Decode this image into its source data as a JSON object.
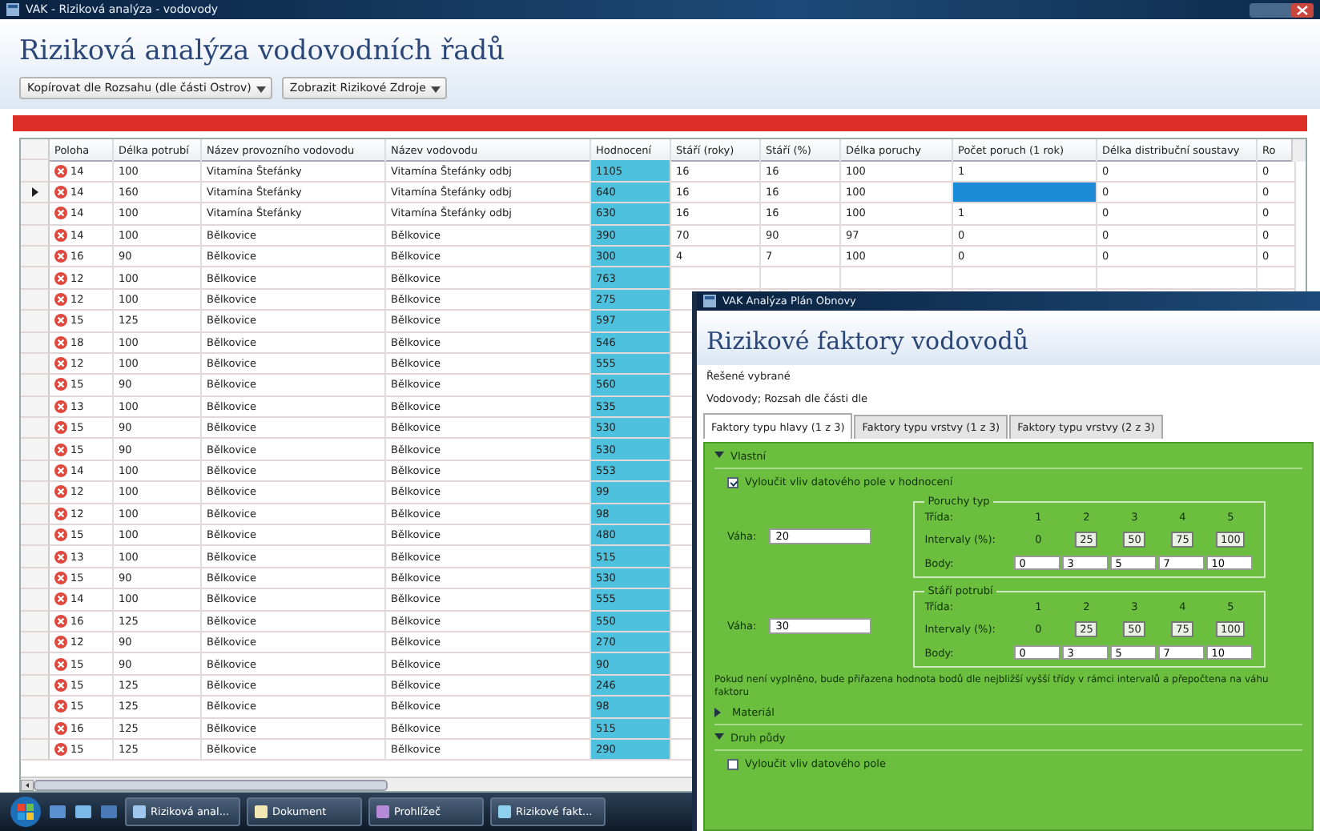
{
  "window": {
    "title": "VAK - Riziková analýza - vodovody"
  },
  "header": {
    "title": "Riziková analýza vodovodních řadů"
  },
  "toolbar": [
    {
      "label": "Kopírovat dle Rozsahu (dle části Ostrov)"
    },
    {
      "label": "Zobrazit Rizikové Zdroje"
    }
  ],
  "table": {
    "columns": [
      {
        "label": "Poloha",
        "highlighted": false
      },
      {
        "label": "Délka potrubí",
        "highlighted": false
      },
      {
        "label": "Název provozního vodovodu",
        "highlighted": false
      },
      {
        "label": "Název vodovodu",
        "highlighted": false
      },
      {
        "label": "Hodnocení",
        "highlighted": true
      },
      {
        "label": "Stáří (roky)",
        "highlighted": false
      },
      {
        "label": "Stáří (%)",
        "highlighted": false
      },
      {
        "label": "Délka poruchy",
        "highlighted": false
      },
      {
        "label": "Počet poruch (1 rok)",
        "highlighted": false
      },
      {
        "label": "Délka distribuční soustavy",
        "highlighted": false
      },
      {
        "label": "Ro",
        "highlighted": false
      }
    ],
    "rows": [
      {
        "current": false,
        "cells": [
          "14",
          "100",
          "Vitamína Štefánky",
          "Vitamína Štefánky odbj",
          "1105"
        ],
        "more": [
          {
            "text": "16",
            "selected": false
          },
          {
            "text": "16",
            "selected": false
          },
          {
            "text": "100",
            "selected": false
          },
          {
            "text": "1",
            "selected": false
          },
          {
            "text": "0",
            "selected": false
          },
          {
            "text": "0",
            "selected": false
          }
        ]
      },
      {
        "current": true,
        "cells": [
          "14",
          "160",
          "Vitamína Štefánky",
          "Vitamína Štefánky odbj",
          "640"
        ],
        "more": [
          {
            "text": "16",
            "selected": false
          },
          {
            "text": "16",
            "selected": false
          },
          {
            "text": "100",
            "selected": false
          },
          {
            "selected": true
          },
          {
            "text": "0",
            "selected": false
          },
          {
            "text": "0",
            "selected": false
          }
        ]
      },
      {
        "current": false,
        "cells": [
          "14",
          "100",
          "Vitamína Štefánky",
          "Vitamína Štefánky odbj",
          "630"
        ],
        "more": [
          {
            "text": "16",
            "selected": false
          },
          {
            "text": "16",
            "selected": false
          },
          {
            "text": "100",
            "selected": false
          },
          {
            "text": "1",
            "selected": false
          },
          {
            "text": "0",
            "selected": false
          },
          {
            "text": "0",
            "selected": false
          }
        ]
      },
      {
        "current": false,
        "cells": [
          "14",
          "100",
          "Bělkovice",
          "Bělkovice",
          "390"
        ],
        "more": [
          {
            "text": "70",
            "selected": false
          },
          {
            "text": "90",
            "selected": false
          },
          {
            "text": "97",
            "selected": false
          },
          {
            "text": "0",
            "selected": false
          },
          {
            "text": "0",
            "selected": false
          },
          {
            "text": "0",
            "selected": false
          }
        ]
      },
      {
        "current": false,
        "cells": [
          "16",
          "90",
          "Bělkovice",
          "Bělkovice",
          "300"
        ],
        "more": [
          {
            "text": "4",
            "selected": false
          },
          {
            "text": "7",
            "selected": false
          },
          {
            "text": "100",
            "selected": false
          },
          {
            "text": "0",
            "selected": false
          },
          {
            "text": "0",
            "selected": false
          },
          {
            "text": "0",
            "selected": false
          }
        ]
      },
      {
        "current": false,
        "cells": [
          "12",
          "100",
          "Bělkovice",
          "Bělkovice",
          "763"
        ]
      },
      {
        "current": false,
        "cells": [
          "12",
          "100",
          "Bělkovice",
          "Bělkovice",
          "275"
        ]
      },
      {
        "current": false,
        "cells": [
          "15",
          "125",
          "Bělkovice",
          "Bělkovice",
          "597"
        ]
      },
      {
        "current": false,
        "cells": [
          "18",
          "100",
          "Bělkovice",
          "Bělkovice",
          "546"
        ]
      },
      {
        "current": false,
        "cells": [
          "12",
          "100",
          "Bělkovice",
          "Bělkovice",
          "555"
        ]
      },
      {
        "current": false,
        "cells": [
          "15",
          "90",
          "Bělkovice",
          "Bělkovice",
          "560"
        ]
      },
      {
        "current": false,
        "cells": [
          "13",
          "100",
          "Bělkovice",
          "Bělkovice",
          "535"
        ]
      },
      {
        "current": false,
        "cells": [
          "15",
          "90",
          "Bělkovice",
          "Bělkovice",
          "530"
        ]
      },
      {
        "current": false,
        "cells": [
          "15",
          "90",
          "Bělkovice",
          "Bělkovice",
          "530"
        ]
      },
      {
        "current": false,
        "cells": [
          "14",
          "100",
          "Bělkovice",
          "Bělkovice",
          "553"
        ]
      },
      {
        "current": false,
        "cells": [
          "12",
          "100",
          "Bělkovice",
          "Bělkovice",
          "99"
        ]
      },
      {
        "current": false,
        "cells": [
          "12",
          "100",
          "Bělkovice",
          "Bělkovice",
          "98"
        ]
      },
      {
        "current": false,
        "cells": [
          "15",
          "100",
          "Bělkovice",
          "Bělkovice",
          "480"
        ]
      },
      {
        "current": false,
        "cells": [
          "13",
          "100",
          "Bělkovice",
          "Bělkovice",
          "515"
        ]
      },
      {
        "current": false,
        "cells": [
          "15",
          "90",
          "Bělkovice",
          "Bělkovice",
          "530"
        ]
      },
      {
        "current": false,
        "cells": [
          "14",
          "100",
          "Bělkovice",
          "Bělkovice",
          "555"
        ]
      },
      {
        "current": false,
        "cells": [
          "16",
          "125",
          "Bělkovice",
          "Bělkovice",
          "550"
        ]
      },
      {
        "current": false,
        "cells": [
          "12",
          "90",
          "Bělkovice",
          "Bělkovice",
          "270"
        ]
      },
      {
        "current": false,
        "cells": [
          "15",
          "90",
          "Bělkovice",
          "Bělkovice",
          "90"
        ]
      },
      {
        "current": false,
        "cells": [
          "15",
          "125",
          "Bělkovice",
          "Bělkovice",
          "246"
        ]
      },
      {
        "current": false,
        "cells": [
          "15",
          "125",
          "Bělkovice",
          "Bělkovice",
          "98"
        ]
      },
      {
        "current": false,
        "cells": [
          "16",
          "125",
          "Bělkovice",
          "Bělkovice",
          "515"
        ]
      },
      {
        "current": false,
        "cells": [
          "15",
          "125",
          "Bělkovice",
          "Bělkovice",
          "290"
        ]
      }
    ]
  },
  "taskbar": {
    "tasks": [
      {
        "label": "Riziková anal..."
      },
      {
        "label": "Dokument"
      },
      {
        "label": "Prohlížeč"
      },
      {
        "label": "Rizikové fakt..."
      }
    ]
  },
  "dialog": {
    "title": "VAK Analýza Plán Obnovy",
    "heading": "Rizikové faktory vodovodů",
    "subtitle": "Řešené vybrané",
    "scope": "Vodovody; Rozsah dle části dle",
    "tabs": [
      {
        "label": "Faktory typu hlavy (1 z 3)",
        "selected": true
      },
      {
        "label": "Faktory typu vrstvy (1 z 3)",
        "selected": false
      },
      {
        "label": "Faktory typu vrstvy (2 z 3)",
        "selected": false
      }
    ],
    "sections": [
      {
        "title": "Vlastní",
        "expanded": true,
        "checkbox": {
          "label": "Vyloučit vliv datového pole v hodnocení",
          "checked": true
        },
        "groups": [
          {
            "weight_label": "Váha:",
            "weight": "20",
            "legend": "Poruchy typ",
            "rows": [
              {
                "label": "Třída:",
                "kind": "plain",
                "values": [
                  "1",
                  "2",
                  "3",
                  "4",
                  "5"
                ]
              },
              {
                "label": "Intervaly (%):",
                "kind": "interval",
                "values": [
                  "0",
                  "25",
                  "50",
                  "75",
                  "100"
                ]
              },
              {
                "label": "Body:",
                "kind": "field",
                "values": [
                  "0",
                  "3",
                  "5",
                  "7",
                  "10"
                ]
              }
            ]
          },
          {
            "weight_label": "Váha:",
            "weight": "30",
            "legend": "Stáří potrubí",
            "rows": [
              {
                "label": "Třída:",
                "kind": "plain",
                "values": [
                  "1",
                  "2",
                  "3",
                  "4",
                  "5"
                ]
              },
              {
                "label": "Intervaly (%):",
                "kind": "interval",
                "values": [
                  "0",
                  "25",
                  "50",
                  "75",
                  "100"
                ]
              },
              {
                "label": "Body:",
                "kind": "field",
                "values": [
                  "0",
                  "3",
                  "5",
                  "7",
                  "10"
                ]
              }
            ]
          }
        ],
        "note": "Pokud není vyplněno, bude přiřazena hodnota bodů dle nejbližší vyšší třídy v rámci intervalů a přepočtena na váhu faktoru"
      },
      {
        "title": "Materiál",
        "expanded": false
      },
      {
        "title": "Druh půdy",
        "expanded": true,
        "checkbox": {
          "label": "Vyloučit vliv datového pole",
          "checked": false
        }
      }
    ]
  }
}
